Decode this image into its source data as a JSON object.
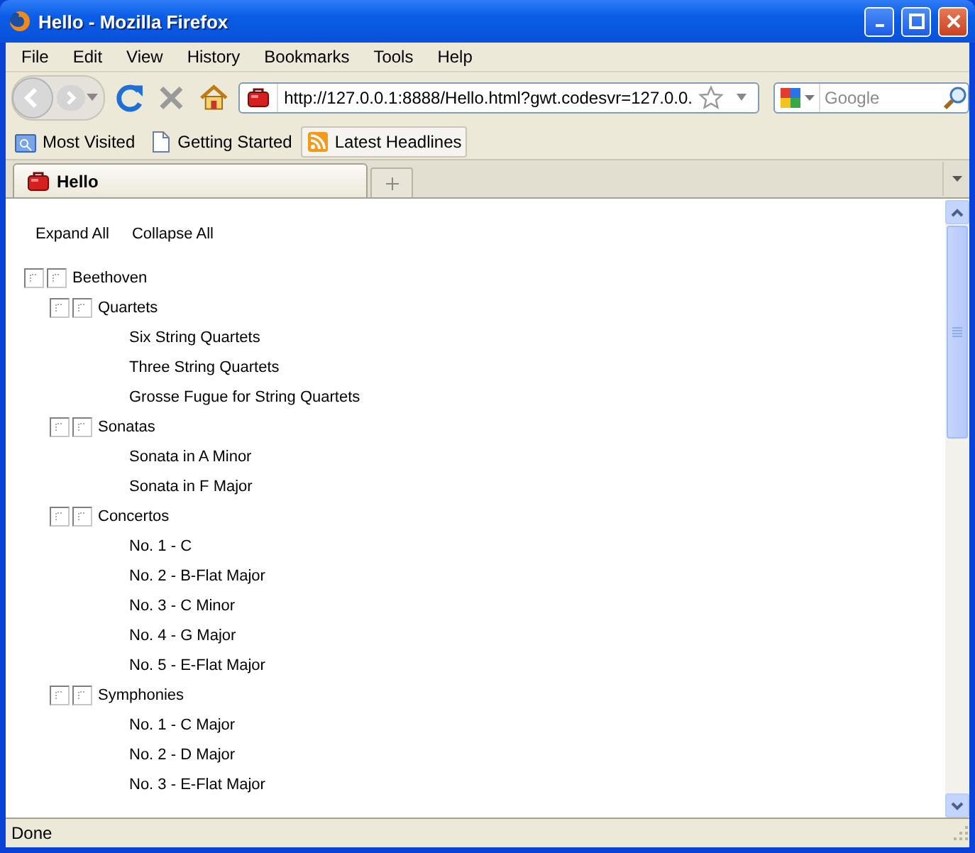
{
  "window": {
    "title": "Hello - Mozilla Firefox"
  },
  "menu": [
    {
      "label": "File"
    },
    {
      "label": "Edit"
    },
    {
      "label": "View"
    },
    {
      "label": "History"
    },
    {
      "label": "Bookmarks"
    },
    {
      "label": "Tools"
    },
    {
      "label": "Help"
    }
  ],
  "toolbar": {
    "url": "http://127.0.0.1:8888/Hello.html?gwt.codesvr=127.0.0.",
    "search": {
      "placeholder": "Google"
    }
  },
  "bookmarks": [
    {
      "label": "Most Visited",
      "kind": "folder"
    },
    {
      "label": "Getting Started",
      "kind": "page"
    },
    {
      "label": "Latest Headlines",
      "kind": "feed"
    }
  ],
  "tabs": [
    {
      "label": "Hello",
      "selected": true
    }
  ],
  "page": {
    "actions": [
      "Expand All",
      "Collapse All"
    ],
    "tree": [
      {
        "label": "Beethoven",
        "expanded": true,
        "children": [
          {
            "label": "Quartets",
            "expanded": true,
            "children": [
              {
                "label": "Six String Quartets"
              },
              {
                "label": "Three String Quartets"
              },
              {
                "label": "Grosse Fugue for String Quartets"
              }
            ]
          },
          {
            "label": "Sonatas",
            "expanded": true,
            "children": [
              {
                "label": "Sonata in A Minor"
              },
              {
                "label": "Sonata in F Major"
              }
            ]
          },
          {
            "label": "Concertos",
            "expanded": true,
            "children": [
              {
                "label": "No. 1 - C"
              },
              {
                "label": "No. 2 - B-Flat Major"
              },
              {
                "label": "No. 3 - C Minor"
              },
              {
                "label": "No. 4 - G Major"
              },
              {
                "label": "No. 5 - E-Flat Major"
              }
            ]
          },
          {
            "label": "Symphonies",
            "expanded": true,
            "children": [
              {
                "label": "No. 1 - C Major"
              },
              {
                "label": "No. 2 - D Major"
              },
              {
                "label": "No. 3 - E-Flat Major"
              }
            ]
          }
        ]
      }
    ]
  },
  "status_bar": "Done"
}
